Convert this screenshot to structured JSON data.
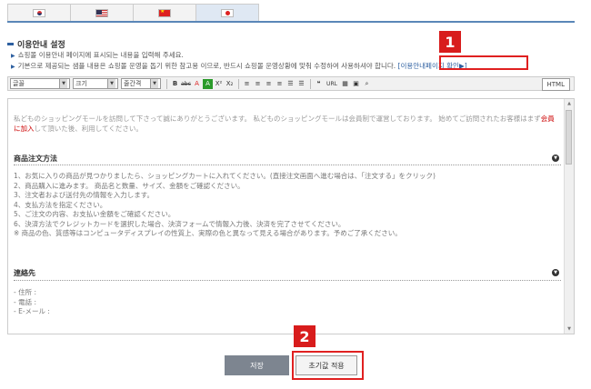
{
  "tabs": [
    {
      "flag": "korea-flag-icon",
      "active": false
    },
    {
      "flag": "usa-flag-icon",
      "active": false
    },
    {
      "flag": "china-flag-icon",
      "active": false
    },
    {
      "flag": "japan-flag-icon",
      "active": true
    }
  ],
  "section": {
    "title": "이용안내 설정",
    "note1": "쇼핑몰 이용안내 페이지에 표시되는 내용을 입력해 주세요.",
    "note2": "기본으로 제공되는 샘플 내용은 쇼핑몰 운영을 돕기 위한 참고용 이므로, 반드시 쇼핑몰 운영상황에 맞춰 수정하여 사용하셔야 합니다.",
    "preview_link": "[이용안내페이지 확인▶]"
  },
  "toolbar": {
    "font": "글꼴",
    "size": "크기",
    "line_spacing": "줄간격",
    "html_label": "HTML"
  },
  "editor": {
    "intro_part1": "私どものショッピングモールを訪問して下さって誠にありがとうございます。 私どものショッピングモールは会員制で運営しております。 始めてご訪問されたお客様はまず",
    "intro_red": "会員に加入",
    "intro_part2": "して頂いた後、利用してください。",
    "order_heading": "商品注文方法",
    "order_lines": [
      "1、お気に入りの商品が見つかりましたら、ショッピングカートに入れてください。(直接注文画面へ進む場合は、「注文する」をクリック)",
      "2、商品購入に進みます。 商品名と数量、サイズ、金額をご確認ください。",
      "3、注文者および送付先の情報を入力します。",
      "4、支払方法を指定ください。",
      "5、ご注文の内容、お支払い金額をご確認ください。",
      "6、決済方法でクレジットカードを選択した場合、決済フォームで情報入力後、決済を完了させてください。",
      "※ 商品の色、質感等はコンピュータディスプレイの性質上、実際の色と異なって見える場合があります。予めご了承ください。"
    ],
    "contact_heading": "連絡先",
    "contact_lines": [
      "- 住所 :",
      "- 電話 :",
      "- E-メール :"
    ]
  },
  "annotations": {
    "badge1": "1",
    "badge2": "2"
  },
  "buttons": {
    "save": "저장",
    "reset": "초기값 적용"
  }
}
